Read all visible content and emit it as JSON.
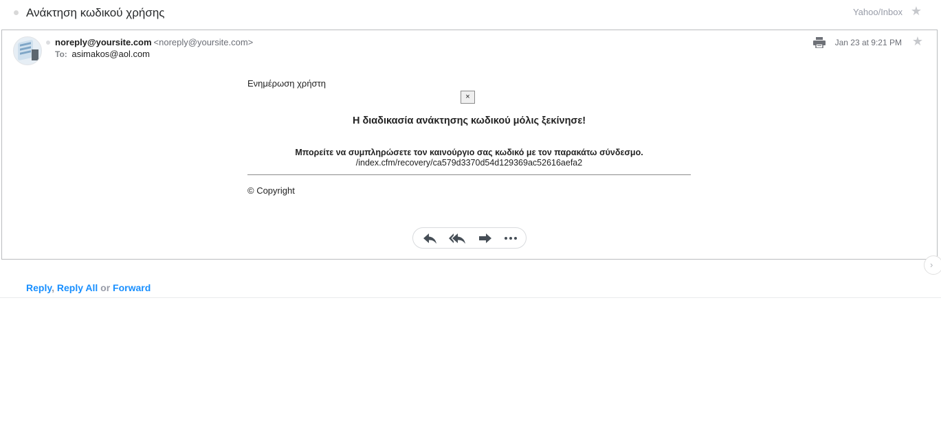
{
  "subject": "Ανάκτηση κωδικού χρήσης",
  "folder_path": "Yahoo/Inbox",
  "message": {
    "sender_name": "noreply@yoursite.com",
    "sender_email": "<noreply@yoursite.com>",
    "to_label": "To:",
    "to_address": "asimakos@aol.com",
    "date": "Jan 23 at 9:21 PM"
  },
  "email_body": {
    "update_title": "Ενημέρωση χρήστη",
    "close_label": "×",
    "headline": "Η διαδικασία ανάκτησης κωδικού μόλις ξεκίνησε!",
    "instruction": "Μπορείτε να συμπληρώσετε τον καινούργιο σας κωδικό με τον παρακάτω σύνδεσμο.",
    "recovery_link": "/index.cfm/recovery/ca579d3370d54d129369ac52616aefa2",
    "copyright": "© Copyright"
  },
  "actions": {
    "reply_icon": "reply-icon",
    "reply_all_icon": "reply-all-icon",
    "forward_icon": "forward-icon",
    "more_icon": "more-icon"
  },
  "footer_links": {
    "reply": "Reply",
    "comma": ",",
    "reply_all": "Reply All",
    "or": "or",
    "forward": "Forward"
  },
  "colors": {
    "link_blue": "#188fff",
    "border": "#b9bbbe",
    "muted_text": "#979ba7"
  }
}
